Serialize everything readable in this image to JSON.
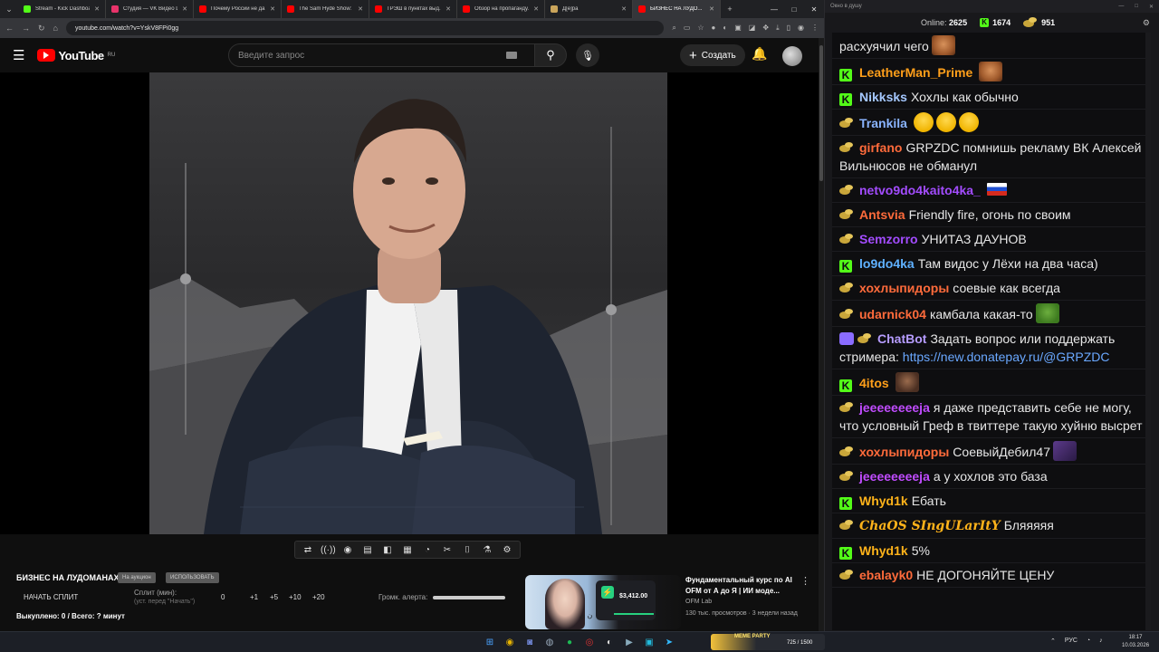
{
  "browser": {
    "tabs": [
      {
        "label": "Stream - Kick Dashboard",
        "color": "#53fc18"
      },
      {
        "label": "Студия — VK Видео Live",
        "color": "#e8336a"
      },
      {
        "label": "Почему России не да...",
        "color": "#ff0000"
      },
      {
        "label": "The Sam Hyde Show: C...",
        "color": "#ff0000"
      },
      {
        "label": "ТРЭШ в пунктах выд...",
        "color": "#ff0000"
      },
      {
        "label": "Обзор на пропаганду...",
        "color": "#ff0000"
      },
      {
        "label": "Д[е]ра",
        "color": "#caa55b"
      },
      {
        "label": "БИЗНЕС НА ЛУДО...",
        "color": "#ff0000"
      }
    ],
    "url": "youtube.com/watch?v=YskV8FPi0gg"
  },
  "youtube": {
    "logo_text": "YouTube",
    "region": "RU",
    "search_placeholder": "Введите запрос",
    "create_label": "Создать"
  },
  "controls": {
    "project_title": "БИЗНЕС НА ЛУДОМАНАХ",
    "pill_a": "На аукцион",
    "pill_b": "ИСПОЛЬЗОВАТЬ",
    "start_split": "НАЧАТЬ СПЛИТ",
    "split_label": "Сплит (мин):",
    "split_hint": "(уст. перед \"Начать\")",
    "split_value": "0",
    "split_buttons": [
      "+1",
      "+5",
      "+10",
      "+20"
    ],
    "alert_label": "Громк. алерта:",
    "spent": "Выкуплено: 0 / Всего: ? минут"
  },
  "recommended": {
    "title": "Фундаментальный курс по AI OFM от А до Я | ИИ моде...",
    "channel": "OFM Lab",
    "meta": "130 тыс. просмотров · 3 недели назад",
    "amount": "$3,412.00",
    "arabic": "ن ي"
  },
  "chat": {
    "window_title": "Окно в душу",
    "online_label": "Online:",
    "online_count": "2625",
    "kick_count": "1674",
    "other_count": "951",
    "messages": [
      {
        "badge": "none",
        "nick": "",
        "color": "#ffffff",
        "text": "расхуячил чего",
        "emote": "em-face"
      },
      {
        "badge": "kick",
        "nick": "LeatherMan_Prime",
        "color": "#ff9f1a",
        "text": "",
        "emote": "em-face"
      },
      {
        "badge": "kick",
        "nick": "Nikksks",
        "color": "#a5c8ff",
        "text": "Хохлы как обычно",
        "emote": ""
      },
      {
        "badge": "coin",
        "nick": "Trankila",
        "color": "#8ab4ff",
        "text": "",
        "emote": "laugh3"
      },
      {
        "badge": "coin",
        "nick": "girfano",
        "color": "#ff6b3b",
        "text": "GRPZDC помнишь рекламу ВК Алексей Вильнюсов не обманул",
        "emote": ""
      },
      {
        "badge": "coin",
        "nick": "netvo9do4kaito4ka_",
        "color": "#a34cff",
        "text": "",
        "emote": "em-flag"
      },
      {
        "badge": "coin",
        "nick": "Antsvia",
        "color": "#ff6b3b",
        "text": "Friendly fire, огонь по своим",
        "emote": ""
      },
      {
        "badge": "coin",
        "nick": "Semzorro",
        "color": "#a34cff",
        "text": "УНИТАЗ ДАУНОВ",
        "emote": ""
      },
      {
        "badge": "kick",
        "nick": "lo9do4ka",
        "color": "#5fb1ff",
        "text": "Там видос у Лёхи на два часа)",
        "emote": ""
      },
      {
        "badge": "coin",
        "nick": "хохлыпидоры",
        "color": "#ff6b3b",
        "text": "соевые как всегда",
        "emote": ""
      },
      {
        "badge": "coin",
        "nick": "udarnick04",
        "color": "#ff6b3b",
        "text": "камбала какая-то",
        "emote": "em-pepe"
      },
      {
        "badge": "bot",
        "nick": "ChatBot",
        "color": "#b69cff",
        "text": "Задать вопрос или поддержать стримера: ",
        "link": "https://new.donatepay.ru/@GRPZDC",
        "emote": ""
      },
      {
        "badge": "kick",
        "nick": "4itos",
        "color": "#ff9f1a",
        "text": "",
        "emote": "em-dark"
      },
      {
        "badge": "coin",
        "nick": "jeeeeeeeeja",
        "color": "#c04cff",
        "text": "я даже представить себе не могу, что условный Греф в твиттере такую хуйню высрет",
        "emote": ""
      },
      {
        "badge": "coin",
        "nick": "хохлыпидоры",
        "color": "#ff6b3b",
        "text": "СоевыйДебил47",
        "emote": "em-purple"
      },
      {
        "badge": "coin",
        "nick": "jeeeeeeeeja",
        "color": "#c04cff",
        "text": "а у хохлов это база",
        "emote": ""
      },
      {
        "badge": "kick",
        "nick": "Whyd1k",
        "color": "#ffb31a",
        "text": "Ебать",
        "emote": ""
      },
      {
        "badge": "coin",
        "nick": "ChaOS SIngULarItY",
        "color": "#ffb31a",
        "text": "Бляяяяя",
        "emote": "",
        "italic": true
      },
      {
        "badge": "kick",
        "nick": "Whyd1k",
        "color": "#ffb31a",
        "text": "5%",
        "emote": ""
      },
      {
        "badge": "coin",
        "nick": "ebalayk0",
        "color": "#ff6b3b",
        "text": "НЕ ДОГОНЯЙТЕ ЦЕНУ",
        "emote": ""
      }
    ]
  },
  "taskbar": {
    "meme_title": "MEME PARTY",
    "meme_value": "725 / 1500",
    "lang": "РУС",
    "time": "18:17",
    "date": "10.03.2026"
  }
}
